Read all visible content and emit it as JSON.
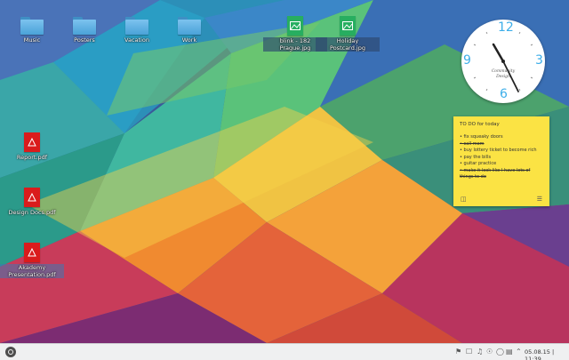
{
  "desktop_icons": {
    "music": "Music",
    "posters": "Posters",
    "vacation": "Vacation",
    "work": "Work",
    "blink": "blink - 182\nPrague.jpg",
    "holiday": "Holiday\nPostcard.jpg",
    "report": "Report.pdf",
    "design_docs": "Design Docs.pdf",
    "akademy": "Akademy\nPresentation.pdf"
  },
  "clock": {
    "time": "11:39",
    "numerals": {
      "n12": "12",
      "n3": "3",
      "n6": "6",
      "n9": "9"
    },
    "brand": "Community Design"
  },
  "note": {
    "title": "TO DO for today",
    "items": [
      {
        "text": "fix squeaky doors",
        "done": false
      },
      {
        "text": "call mom",
        "done": true
      },
      {
        "text": "buy lottery ticket to become rich",
        "done": false
      },
      {
        "text": "pay the bills",
        "done": false
      },
      {
        "text": "guitar practice",
        "done": false
      },
      {
        "text": "make it look like I have lots of things to do",
        "done": true
      }
    ],
    "color": "#fbe344"
  },
  "panel": {
    "datetime": "05.08.15 | 11:39"
  },
  "colors": {
    "accent": "#3daee9",
    "panel": "#eff0f1"
  }
}
